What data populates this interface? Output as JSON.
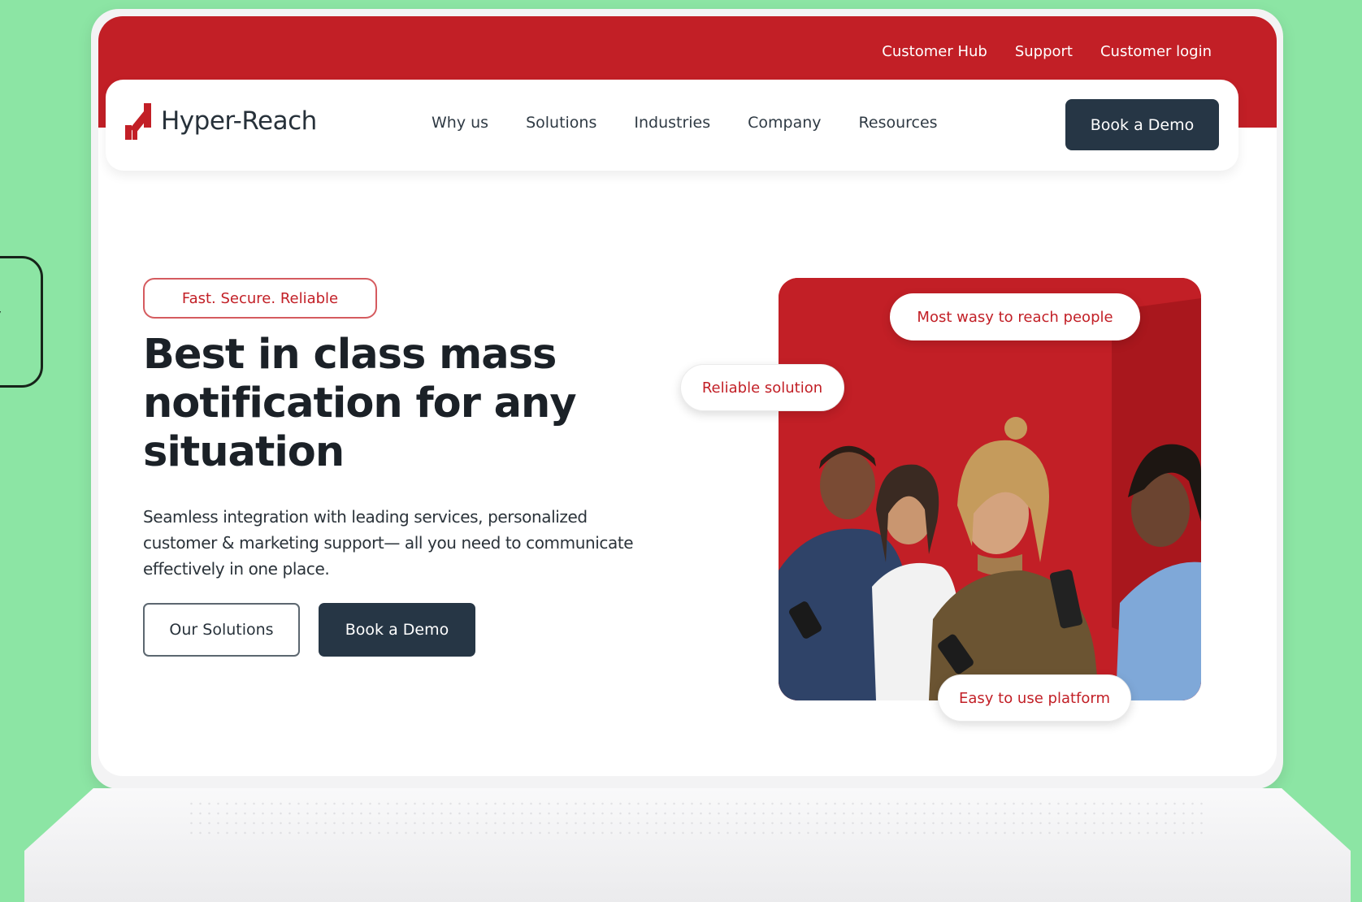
{
  "side_fragment": {
    "glyph": "y"
  },
  "brand": {
    "name": "Hyper-Reach",
    "accent": "#c21f26",
    "dark": "#263645"
  },
  "utility_nav": [
    "Customer Hub",
    "Support",
    "Customer login"
  ],
  "main_nav": {
    "links": [
      "Why us",
      "Solutions",
      "Industries",
      "Company",
      "Resources"
    ],
    "cta": "Book a Demo"
  },
  "hero": {
    "badge": "Fast. Secure. Reliable",
    "title": "Best in class mass notification for any situation",
    "description": "Seamless integration with leading services, personalized customer & marketing support— all you need to communicate effectively in one place.",
    "primary_button": "Our Solutions",
    "secondary_button": "Book a Demo"
  },
  "image_pills": {
    "top": "Most wasy to reach people",
    "left": "Reliable solution",
    "bottom": "Easy to use platform"
  }
}
